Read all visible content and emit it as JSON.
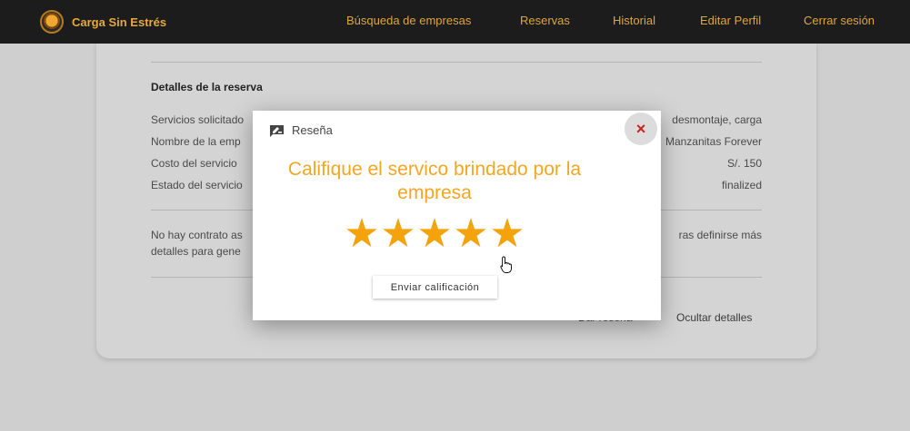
{
  "nav": {
    "brand": "Carga Sin Estrés",
    "links": [
      "Búsqueda de empresas",
      "Reservas",
      "Historial",
      "Editar Perfil",
      "Cerrar sesión"
    ]
  },
  "details": {
    "section_title": "Detalles de la reserva",
    "rows": [
      {
        "label": "Servicios solicitado",
        "value": "desmontaje, carga"
      },
      {
        "label": "Nombre de la emp",
        "value": "Manzanitas Forever"
      },
      {
        "label": "Costo del servicio",
        "value": "S/. 150"
      },
      {
        "label": "Estado del servicio",
        "value": "finalized"
      }
    ],
    "note_left": "No hay contrato as",
    "note_right": "ras definirse más",
    "note_line2": "detalles para gene",
    "review_button": "Dar reseña",
    "hide_button": "Ocultar detalles"
  },
  "modal": {
    "title": "Reseña",
    "close_label": "×",
    "question": "Califique el servico brindado por la empresa",
    "rating": 5,
    "rating_max": 5,
    "star_glyph": "★",
    "submit_label": "Enviar calificación"
  },
  "colors": {
    "accent": "#f4a623",
    "nav_bg": "#1c1c1c",
    "close": "#d32020"
  }
}
